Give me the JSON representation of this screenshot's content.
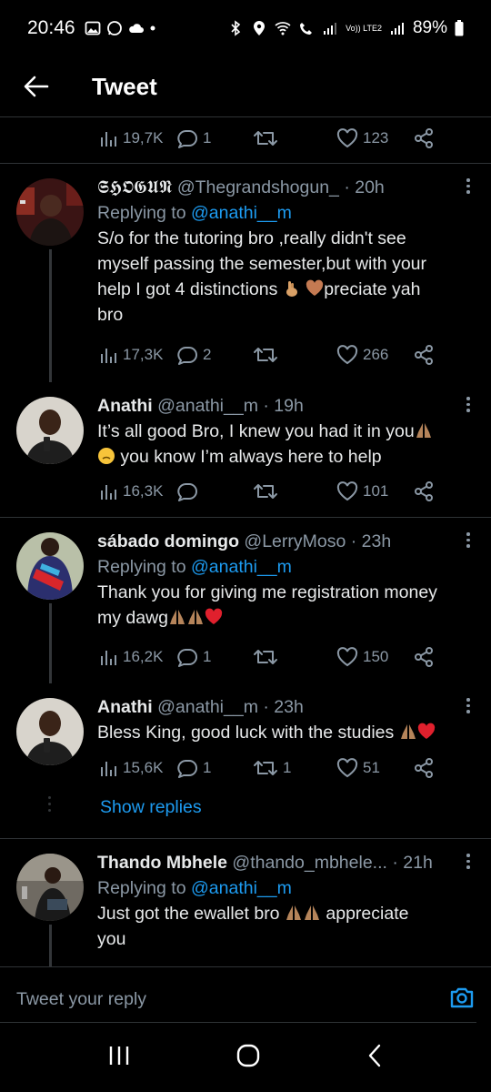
{
  "status_bar": {
    "time": "20:46",
    "network": "Vo)) LTE2",
    "battery": "89%"
  },
  "header": {
    "title": "Tweet"
  },
  "top_actions": {
    "views": "19,7K",
    "replies": "1",
    "retweets": "",
    "likes": "123"
  },
  "tweets": [
    {
      "name": "𝕾𝕳𝕺𝕲𝖀𝕹",
      "handle": "@Thegrandshogun_",
      "time": "· 20h",
      "replying_label": "Replying to",
      "replying_to": "@anathi__m",
      "text_lines": [
        "S/o for the tutoring bro ,really didn't see",
        "myself passing the semester,but with your",
        "help I got 4 distinctions",
        "preciate yah",
        "bro"
      ],
      "views": "17,3K",
      "replies": "2",
      "retweets": "",
      "likes": "266"
    },
    {
      "name": "Anathi",
      "handle": "@anathi__m",
      "time": "· 19h",
      "text_lines": [
        "It’s all good Bro, I knew you had it in you",
        "you know I’m always here to help"
      ],
      "views": "16,3K",
      "replies": "",
      "retweets": "",
      "likes": "101"
    },
    {
      "name": "sábado domingo",
      "handle": "@LerryMoso",
      "time": "· 23h",
      "replying_label": "Replying to",
      "replying_to": "@anathi__m",
      "text_lines": [
        "Thank you for giving me registration money",
        "my dawg"
      ],
      "views": "16,2K",
      "replies": "1",
      "retweets": "",
      "likes": "150"
    },
    {
      "name": "Anathi",
      "handle": "@anathi__m",
      "time": "· 23h",
      "text_lines": [
        "Bless King, good luck with the studies"
      ],
      "views": "15,6K",
      "replies": "1",
      "retweets": "1",
      "likes": "51"
    },
    {
      "name": "Thando Mbhele",
      "handle": "@thando_mbhele...",
      "time": "· 21h",
      "replying_label": "Replying to",
      "replying_to": "@anathi__m",
      "text_lines": [
        "Just got the ewallet bro",
        "appreciate",
        "you"
      ]
    }
  ],
  "show_replies": "Show replies",
  "reply_bar": {
    "placeholder": "Tweet your reply"
  },
  "colors": {
    "accent": "#1d9bf0",
    "muted": "#8b98a5",
    "text": "#e7e9ea",
    "divider": "#2f3336",
    "background": "#000000"
  }
}
